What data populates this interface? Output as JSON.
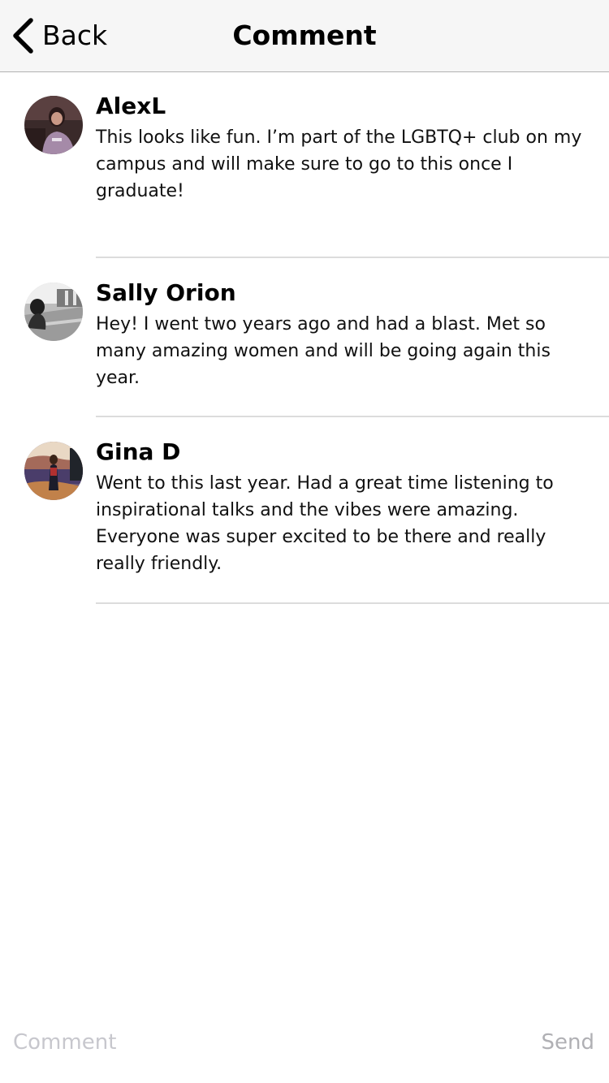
{
  "navbar": {
    "back_label": "Back",
    "back_icon": "chevron-left-icon",
    "title": "Comment"
  },
  "comments": [
    {
      "author": "AlexL",
      "text": "This looks like fun. I’m part of the LGBTQ+ club on my campus and will make sure to go to this once I graduate!"
    },
    {
      "author": "Sally Orion",
      "text": "Hey! I went two years ago and had a blast. Met so many amazing women and will be going again this year."
    },
    {
      "author": "Gina D",
      "text": "Went to this last year. Had a great time listening to inspirational talks and the vibes were amazing. Everyone was super excited to be there and really really friendly."
    }
  ],
  "composer": {
    "placeholder": "Comment",
    "value": "",
    "send_label": "Send"
  }
}
